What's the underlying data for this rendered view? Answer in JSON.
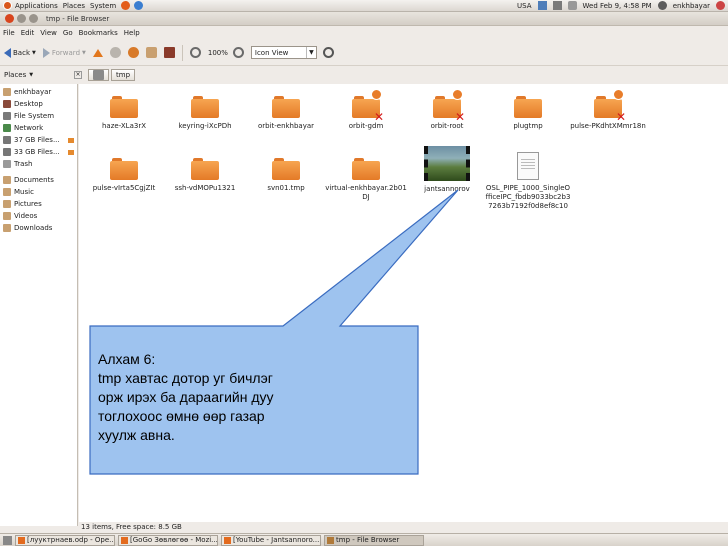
{
  "top_panel": {
    "menus": [
      "Applications",
      "Places",
      "System"
    ],
    "keyboard": "USA",
    "datetime": "Wed Feb  9,  4:58 PM",
    "user": "enkhbayar"
  },
  "window": {
    "title": "tmp - File Browser"
  },
  "menubar": [
    "File",
    "Edit",
    "View",
    "Go",
    "Bookmarks",
    "Help"
  ],
  "toolbar": {
    "back": "Back",
    "forward": "Forward",
    "zoom": "100%",
    "view_mode": "Icon View"
  },
  "location": {
    "places_label": "Places",
    "crumb": "tmp"
  },
  "sidebar": [
    {
      "label": "enkhbayar",
      "color": "#c8a070"
    },
    {
      "label": "Desktop",
      "color": "#8a4a3a"
    },
    {
      "label": "File System",
      "color": "#7a7a7a"
    },
    {
      "label": "Network",
      "color": "#4a8a4a"
    },
    {
      "label": "37 GB Files...",
      "color": "#777777"
    },
    {
      "label": "33 GB Files...",
      "color": "#777777"
    },
    {
      "label": "Trash",
      "color": "#9a9a9a"
    },
    {
      "label": "Documents",
      "color": "#c8a070"
    },
    {
      "label": "Music",
      "color": "#c8a070"
    },
    {
      "label": "Pictures",
      "color": "#c8a070"
    },
    {
      "label": "Videos",
      "color": "#c8a070"
    },
    {
      "label": "Downloads",
      "color": "#c8a070"
    }
  ],
  "files": [
    {
      "name": "haze-XLa3rX",
      "kind": "folder"
    },
    {
      "name": "keyring-iXcPDh",
      "kind": "folder"
    },
    {
      "name": "orbit-enkhbayar",
      "kind": "folder"
    },
    {
      "name": "orbit-gdm",
      "kind": "locked-folder"
    },
    {
      "name": "orbit-root",
      "kind": "locked-folder"
    },
    {
      "name": "plugtmp",
      "kind": "folder"
    },
    {
      "name": "pulse-PKdhtXMmr18n",
      "kind": "locked-folder"
    },
    {
      "name": "pulse-vIrta5CgjZIt",
      "kind": "folder"
    },
    {
      "name": "ssh-vdMOPu1321",
      "kind": "folder"
    },
    {
      "name": "svn01.tmp",
      "kind": "folder"
    },
    {
      "name": "virtual-enkhbayar.2b01DJ",
      "kind": "folder"
    },
    {
      "name": "jantsannorov",
      "kind": "video"
    },
    {
      "name": "OSL_PIPE_1000_SingleOfficeIPC_fbdb9033bc2b37263b7192f0d8ef8c10",
      "kind": "document"
    }
  ],
  "status": "13 items, Free space: 8.5 GB",
  "taskbar": [
    {
      "label": "[лууктрнаев.odp - Ope...",
      "active": false
    },
    {
      "label": "[GoGo Зөвлөгөө - Mozi...",
      "active": false
    },
    {
      "label": "[YouTube - Jantsannoro...",
      "active": false
    },
    {
      "label": "tmp - File Browser",
      "active": true
    }
  ],
  "callout": {
    "lines": [
      "Алхам 6:",
      "tmp хавтас дотор уг бичлэг",
      "орж ирэх ба дараагийн дуу",
      "тоглохоос өмнө өөр газар",
      "хуулж авна."
    ],
    "fill": "#9ec3ef",
    "stroke": "#3a6cc0"
  }
}
